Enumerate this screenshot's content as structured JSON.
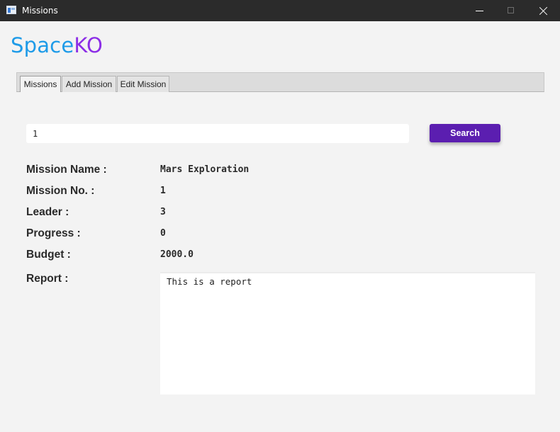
{
  "window": {
    "title": "Missions",
    "icons": {
      "app": "app-window-icon",
      "minimize": "minimize-icon",
      "maximize": "maximize-icon",
      "close": "close-icon"
    }
  },
  "logo": {
    "part1": "Space",
    "part2": "KO",
    "colors": {
      "part1": "#1e9be8",
      "part2": "#8c2ee6"
    }
  },
  "tabs": [
    {
      "label": "Missions",
      "active": true
    },
    {
      "label": "Add Mission",
      "active": false
    },
    {
      "label": "Edit Mission",
      "active": false
    }
  ],
  "search": {
    "value": "1",
    "button_label": "Search",
    "button_color": "#5b1eb0"
  },
  "fields": [
    {
      "label": "Mission Name :",
      "value": "Mars Exploration"
    },
    {
      "label": "Mission No. :",
      "value": "1"
    },
    {
      "label": "Leader :",
      "value": "3"
    },
    {
      "label": "Progress :",
      "value": "0"
    },
    {
      "label": "Budget :",
      "value": "2000.0"
    }
  ],
  "report": {
    "label": "Report :",
    "value": "This is a report"
  }
}
